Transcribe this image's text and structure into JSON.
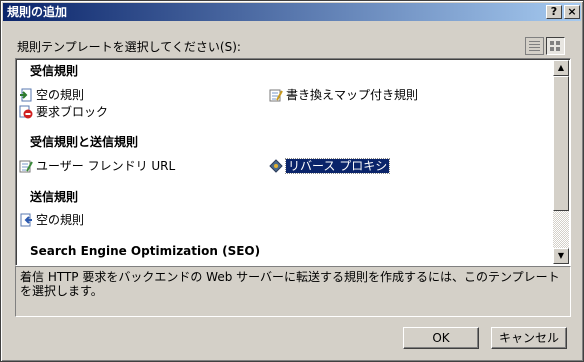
{
  "window": {
    "title": "規則の追加",
    "help_label": "?",
    "close_label": "×"
  },
  "prompt": "規則テンプレートを選択してください(S):",
  "sections": [
    {
      "header": "受信規則",
      "items": [
        {
          "label": "空の規則",
          "icon": "inbound-rule-icon"
        },
        {
          "label": "書き換えマップ付き規則",
          "icon": "rewrite-map-icon"
        },
        {
          "label": "要求ブロック",
          "icon": "block-request-icon"
        }
      ]
    },
    {
      "header": "受信規則と送信規則",
      "items": [
        {
          "label": "ユーザー フレンドリ URL",
          "icon": "friendly-url-icon"
        },
        {
          "label": "リバース プロキシ",
          "icon": "reverse-proxy-icon",
          "selected": true
        }
      ]
    },
    {
      "header": "送信規則",
      "items": [
        {
          "label": "空の規則",
          "icon": "outbound-rule-icon"
        }
      ]
    },
    {
      "header": "Search Engine Optimization (SEO)",
      "items": []
    }
  ],
  "description": "着信 HTTP 要求をバックエンドの Web サーバーに転送する規則を作成するには、このテンプレートを選択します。",
  "buttons": {
    "ok": "OK",
    "cancel": "キャンセル"
  },
  "scrollbar": {
    "up_glyph": "▲",
    "down_glyph": "▼"
  },
  "colors": {
    "titlebar": "#0a246a",
    "selection": "#0a246a",
    "dialog_bg": "#d4d0c8"
  }
}
